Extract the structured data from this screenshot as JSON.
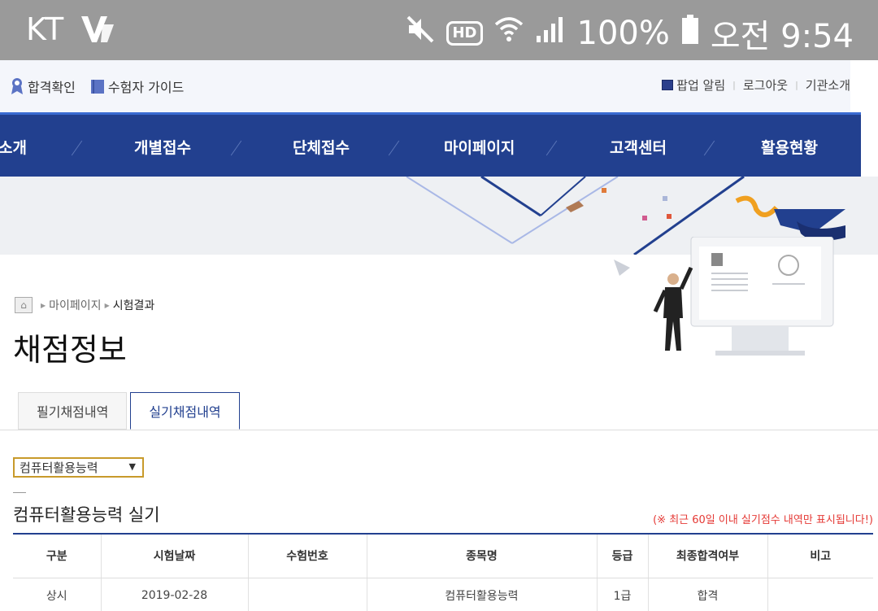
{
  "statusbar": {
    "carrier": "KT",
    "battery": "100%",
    "time": "오전 9:54",
    "hd": "HD"
  },
  "utility": {
    "left": [
      {
        "label": "합격확인",
        "icon": "ribbon-icon"
      },
      {
        "label": "수험자 가이드",
        "icon": "book-icon"
      }
    ],
    "right": [
      "팝업 알림",
      "로그아웃",
      "기관소개"
    ]
  },
  "nav": {
    "items": [
      "소개",
      "개별접수",
      "단체접수",
      "마이페이지",
      "고객센터",
      "활용현황"
    ]
  },
  "breadcrumb": {
    "items": [
      "마이페이지",
      "시험결과"
    ]
  },
  "page": {
    "title": "채점정보"
  },
  "tabs": [
    {
      "label": "필기채점내역",
      "active": false
    },
    {
      "label": "실기채점내역",
      "active": true
    }
  ],
  "select": {
    "value": "컴퓨터활용능력"
  },
  "section": {
    "title": "컴퓨터활용능력 실기",
    "notice": "(※ 최근 60일 이내 실기점수 내역만 표시됩니다!)"
  },
  "table": {
    "headers": [
      "구분",
      "시험날짜",
      "수험번호",
      "종목명",
      "등급",
      "최종합격여부",
      "비고"
    ],
    "rows": [
      [
        "상시",
        "2019-02-28",
        "",
        "컴퓨터활용능력",
        "1급",
        "합격",
        ""
      ]
    ]
  },
  "colors": {
    "nav": "#22408f",
    "accent": "#3a6bd1",
    "notice": "#e53935",
    "select_border": "#c89a2b"
  }
}
